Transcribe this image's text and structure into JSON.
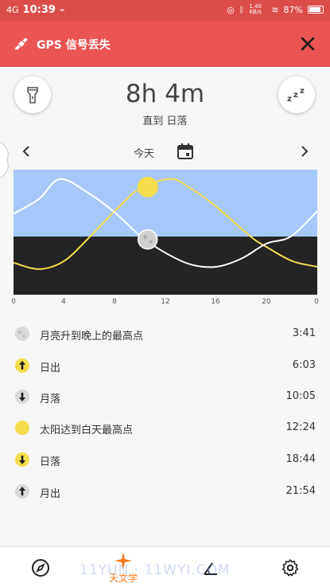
{
  "status_bar": {
    "network": "4G",
    "time": "10:39",
    "speed": "1.40 KB/s",
    "battery": "87%",
    "battery_level": 0.87
  },
  "gps_banner": {
    "message": "GPS 信号丢失",
    "icons": {
      "satellite": "satellite-icon",
      "close": "close-icon"
    }
  },
  "header": {
    "countdown": "8h 4m",
    "until_label": "直到 日落",
    "icons": {
      "left": "flashlight-icon",
      "right": "sleep-zzz-icon"
    }
  },
  "date_nav": {
    "label": "今天",
    "icons": {
      "prev": "chevron-left-icon",
      "next": "chevron-right-icon",
      "calendar": "calendar-icon"
    }
  },
  "chart_data": {
    "type": "line",
    "x_label_ticks": [
      "0",
      "4",
      "8",
      "12",
      "16",
      "20",
      "0"
    ],
    "xlim": [
      0,
      24
    ],
    "ylim": [
      -1,
      1
    ],
    "horizon": 0,
    "colors": {
      "day_sky": "#a6c8fb",
      "night": "#242424",
      "sun": "#f6dd4e",
      "moon": "#ffffff"
    },
    "series": [
      {
        "name": "sun",
        "color": "#f6dd4e",
        "x": [
          0,
          2,
          4,
          6.05,
          8,
          10,
          12.4,
          14,
          16,
          18.73,
          20,
          22,
          24
        ],
        "y": [
          -0.45,
          -0.56,
          -0.42,
          0.0,
          0.38,
          0.72,
          0.86,
          0.72,
          0.45,
          0.0,
          -0.18,
          -0.42,
          -0.52
        ]
      },
      {
        "name": "moon",
        "color": "#ffffff",
        "x": [
          0,
          2,
          3.68,
          6,
          8,
          10.08,
          12,
          14,
          16,
          18,
          20,
          21.9,
          24
        ],
        "y": [
          0.34,
          0.56,
          0.86,
          0.64,
          0.36,
          0.0,
          -0.28,
          -0.48,
          -0.52,
          -0.38,
          -0.12,
          0.0,
          0.38
        ]
      }
    ],
    "markers": [
      {
        "name": "sun",
        "x": 10.6,
        "y": 0.74
      },
      {
        "name": "moon",
        "x": 10.6,
        "y": -0.05
      }
    ]
  },
  "events": [
    {
      "name": "月亮升到晚上的最高点",
      "time": "3:41",
      "icon": "moon-phase-icon"
    },
    {
      "name": "日出",
      "time": "6:03",
      "icon": "sunrise-arrow-icon"
    },
    {
      "name": "月落",
      "time": "10:05",
      "icon": "moonset-arrow-icon"
    },
    {
      "name": "太阳达到白天最高点",
      "time": "12:24",
      "icon": "sun-icon"
    },
    {
      "name": "日落",
      "time": "18:44",
      "icon": "sunset-arrow-icon"
    },
    {
      "name": "月出",
      "time": "21:54",
      "icon": "moonrise-arrow-icon"
    }
  ],
  "bottom_nav": {
    "items": [
      {
        "icon": "compass-icon",
        "label": ""
      },
      {
        "icon": "astronomy-star-icon",
        "label": "天文学",
        "active": true
      },
      {
        "icon": "angle-icon",
        "label": ""
      },
      {
        "icon": "gear-icon",
        "label": ""
      }
    ]
  },
  "watermark": "11YUN · 11WYI.COM"
}
